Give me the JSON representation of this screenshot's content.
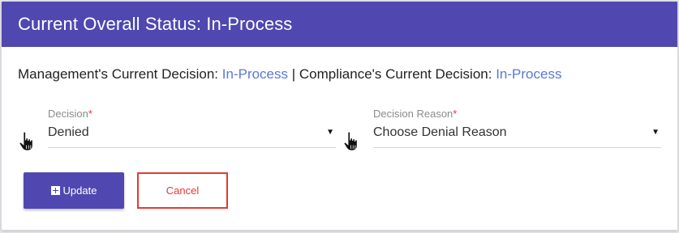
{
  "header": {
    "title": "Current Overall Status: In-Process"
  },
  "status_line": {
    "management_label": "Management's Current Decision:",
    "management_value": "In-Process",
    "separator": "|",
    "compliance_label": "Compliance's Current Decision:",
    "compliance_value": "In-Process"
  },
  "fields": {
    "decision": {
      "label": "Decision",
      "required_mark": "*",
      "value": "Denied",
      "caret": "▼"
    },
    "decision_reason": {
      "label": "Decision Reason",
      "required_mark": "*",
      "value": "Choose Denial Reason",
      "caret": "▼"
    }
  },
  "buttons": {
    "update_label": "Update",
    "update_icon": "plus-square-icon",
    "cancel_label": "Cancel"
  },
  "icons": {
    "pointer": "hand-pointer-icon"
  },
  "colors": {
    "brand": "#5048b0",
    "link": "#5b78d6",
    "danger": "#e53935"
  }
}
